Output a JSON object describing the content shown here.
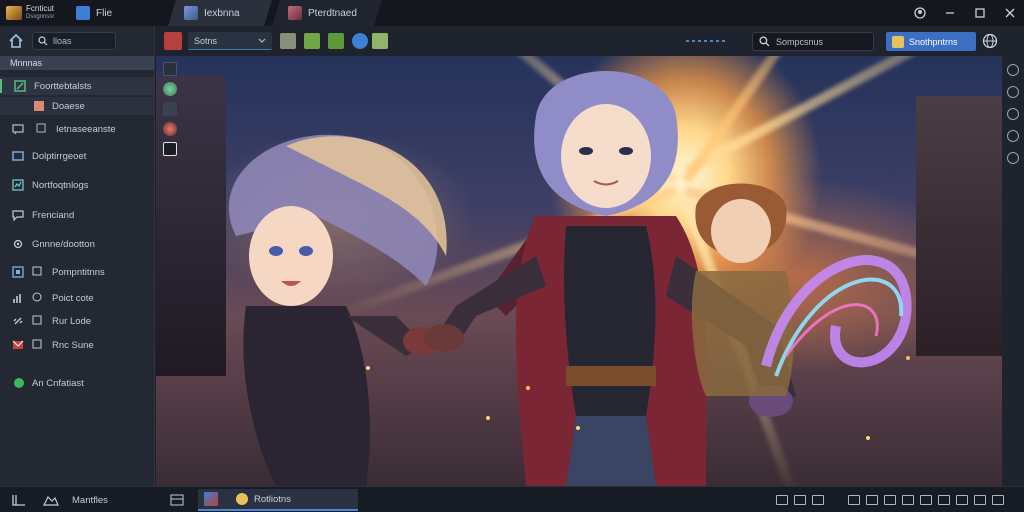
{
  "app": {
    "logo_line1": "Fcnticut",
    "logo_line2": "Dsxgnnssr"
  },
  "tabs": [
    {
      "label": "Flie"
    },
    {
      "label": "Iexbnna"
    },
    {
      "label": "Pterdtnaed"
    }
  ],
  "sidebar": {
    "search_label": "lloas",
    "section_title": "Mnnnas",
    "items": [
      {
        "label": "Foorttebtalsts"
      },
      {
        "label": "Doaese"
      },
      {
        "label": "Ietnaseeanste"
      },
      {
        "label": "Dolptirrgeoet"
      },
      {
        "label": "Nortfoqtnlogs"
      },
      {
        "label": "Frenciand"
      },
      {
        "label": "Gnnne/dootton"
      },
      {
        "label": "Pompntitnns"
      },
      {
        "label": "Poict cote"
      },
      {
        "label": "Rur Lode"
      },
      {
        "label": "Rnc Sune"
      },
      {
        "label": "An Cnfatiast"
      }
    ]
  },
  "toolbar": {
    "select_value": "Sotns",
    "search_label": "Sompcsnus",
    "primary_label": "Snothpntrns"
  },
  "bottombar": {
    "left_label": "Mantfles",
    "task_label": "Rotliotns"
  }
}
